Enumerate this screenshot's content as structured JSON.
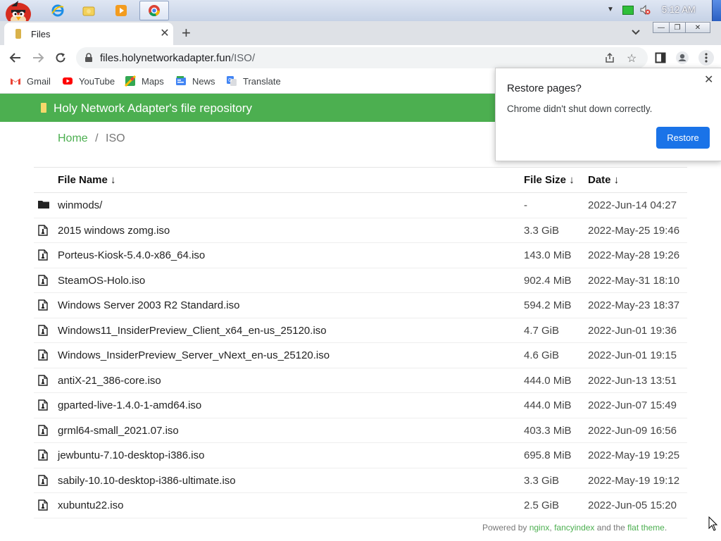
{
  "taskbar": {
    "apps": [
      "angry-birds",
      "internet-explorer",
      "folder",
      "media-player",
      "chrome"
    ],
    "clock": "5:12 AM"
  },
  "tab": {
    "title": "Files"
  },
  "toolbar": {
    "url_host": "files.holynetworkadapter.fun",
    "url_path": "/ISO/"
  },
  "bookmarks": [
    {
      "label": "Gmail",
      "icon": "gmail-icon",
      "color": "#ea4335"
    },
    {
      "label": "YouTube",
      "icon": "youtube-icon",
      "color": "#ff0000"
    },
    {
      "label": "Maps",
      "icon": "maps-icon",
      "color": "#34a853"
    },
    {
      "label": "News",
      "icon": "news-icon",
      "color": "#4285f4"
    },
    {
      "label": "Translate",
      "icon": "translate-icon",
      "color": "#4285f4"
    }
  ],
  "page": {
    "banner_title": "Holy Network Adapter's file repository",
    "breadcrumb": {
      "home": "Home",
      "sep": "/",
      "current": "ISO"
    },
    "columns": {
      "name": "File Name ↓",
      "size": "File Size ↓",
      "date": "Date ↓"
    },
    "files": [
      {
        "name": "winmods/",
        "size": "-",
        "date": "2022-Jun-14 04:27",
        "type": "folder"
      },
      {
        "name": "2015 windows zomg.iso",
        "size": "3.3 GiB",
        "date": "2022-May-25 19:46",
        "type": "file"
      },
      {
        "name": "Porteus-Kiosk-5.4.0-x86_64.iso",
        "size": "143.0 MiB",
        "date": "2022-May-28 19:26",
        "type": "file"
      },
      {
        "name": "SteamOS-Holo.iso",
        "size": "902.4 MiB",
        "date": "2022-May-31 18:10",
        "type": "file"
      },
      {
        "name": "Windows Server 2003 R2 Standard.iso",
        "size": "594.2 MiB",
        "date": "2022-May-23 18:37",
        "type": "file"
      },
      {
        "name": "Windows11_InsiderPreview_Client_x64_en-us_25120.iso",
        "size": "4.7 GiB",
        "date": "2022-Jun-01 19:36",
        "type": "file"
      },
      {
        "name": "Windows_InsiderPreview_Server_vNext_en-us_25120.iso",
        "size": "4.6 GiB",
        "date": "2022-Jun-01 19:15",
        "type": "file"
      },
      {
        "name": "antiX-21_386-core.iso",
        "size": "444.0 MiB",
        "date": "2022-Jun-13 13:51",
        "type": "file"
      },
      {
        "name": "gparted-live-1.4.0-1-amd64.iso",
        "size": "444.0 MiB",
        "date": "2022-Jun-07 15:49",
        "type": "file"
      },
      {
        "name": "grml64-small_2021.07.iso",
        "size": "403.3 MiB",
        "date": "2022-Jun-09 16:56",
        "type": "file"
      },
      {
        "name": "jewbuntu-7.10-desktop-i386.iso",
        "size": "695.8 MiB",
        "date": "2022-May-19 19:25",
        "type": "file"
      },
      {
        "name": "sabily-10.10-desktop-i386-ultimate.iso",
        "size": "3.3 GiB",
        "date": "2022-May-19 19:12",
        "type": "file"
      },
      {
        "name": "xubuntu22.iso",
        "size": "2.5 GiB",
        "date": "2022-Jun-05 15:20",
        "type": "file"
      }
    ],
    "footer": {
      "prefix": "Powered by ",
      "link1": "nginx",
      "sep1": ", ",
      "link2": "fancyindex",
      "mid": " and the ",
      "link3": "flat theme",
      "suffix": "."
    }
  },
  "popup": {
    "title": "Restore pages?",
    "message": "Chrome didn't shut down correctly.",
    "button": "Restore"
  },
  "colors": {
    "banner": "#4caf50",
    "accent": "#1a73e8"
  }
}
